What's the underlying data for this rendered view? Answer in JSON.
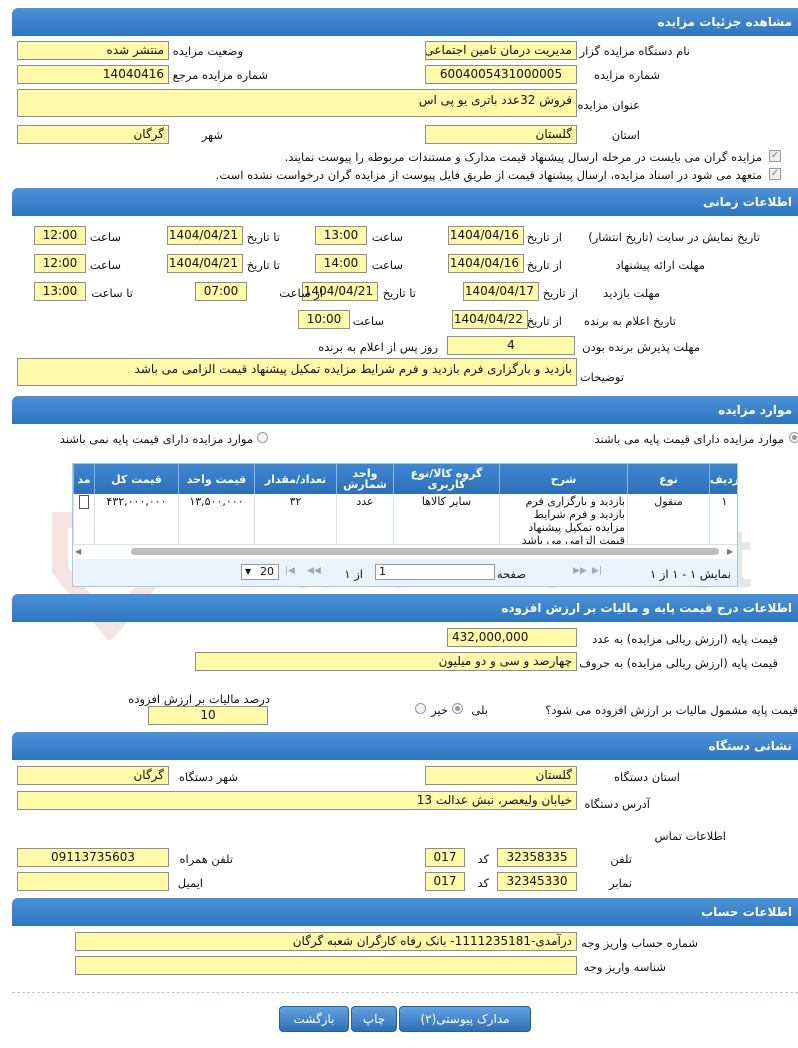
{
  "watermark": "AriaTender.net",
  "sections": {
    "details": "مشاهده جزئیات مزایده",
    "timing": "اطلاعات زمانی",
    "items": "موارد مزایده",
    "price": "اطلاعات درج قیمت پایه و مالیات بر ارزش افزوده",
    "address": "نشانی دستگاه",
    "account": "اطلاعات حساب"
  },
  "details": {
    "org_label": "نام دستگاه مزایده گزار",
    "org_value": "مدیریت درمان تامین اجتماعی",
    "status_label": "وضعیت مزایده",
    "status_value": "منتشر شده",
    "num_label": "شماره مزایده",
    "num_value": "6004005431000005",
    "ref_label": "شماره مزایده مرجع",
    "ref_value": "14040416",
    "title_label": "عنوان مزایده",
    "title_value": "فروش 32عدد باتری یو پی اس",
    "province_label": "استان",
    "province_value": "گلستان",
    "city_label": "شهر",
    "city_value": "گرگان",
    "check1": "مزایده گران می بایست در مرحله ارسال پیشنهاد قیمت مدارک و مستندات مربوطه را پیوست نمایند.",
    "check2": "متعهد می شود در اسناد مزایده، ارسال پیشنهاد قیمت از طریق فایل پیوست از مزایده گران درخواست نشده است."
  },
  "timing": {
    "r1_label": "تاریخ نمایش در سایت (تاریخ انتشار)",
    "r1_from_label": "از تاریخ",
    "r1_from": "1404/04/16",
    "r1_time1_label": "ساعت",
    "r1_time1": "13:00",
    "r1_to_label": "تا تاریخ",
    "r1_to": "1404/04/21",
    "r1_time2_label": "ساعت",
    "r1_time2": "12:00",
    "r2_label": "مهلت ارائه پیشنهاد",
    "r2_from_label": "از تاریخ",
    "r2_from": "1404/04/16",
    "r2_time1_label": "ساعت",
    "r2_time1": "14:00",
    "r2_to_label": "تا تاریخ",
    "r2_to": "1404/04/21",
    "r2_time2_label": "ساعت",
    "r2_time2": "12:00",
    "r3_label": "مهلت بازدید",
    "r3_from_label": "از تاریخ",
    "r3_from": "1404/04/17",
    "r3_to_label": "تا تاریخ",
    "r3_to": "1404/04/21",
    "r3_time1_label": "از ساعت",
    "r3_time1": "07:00",
    "r3_time2_label": "تا ساعت",
    "r3_time2": "13:00",
    "r4_label": "تاریخ اعلام به برنده",
    "r4_from_label": "از تاریخ",
    "r4_from": "1404/04/22",
    "r4_time_label": "ساعت",
    "r4_time": "10:00",
    "r5_label": "مهلت پذیرش برنده بودن",
    "r5_value": "4",
    "r5_suffix": "روز پس از اعلام به برنده",
    "desc_label": "توضیحات",
    "desc_value": "بازدید و بارگزاری فرم بازدید و فرم  شرایط مزایده  تمکیل پیشنهاد قیمت الزامی می باشد"
  },
  "items": {
    "radio_yes": "موارد مزایده دارای قیمت پایه می باشند",
    "radio_no": "موارد مزایده دارای قیمت پایه نمی باشند",
    "columns": [
      "ردیف",
      "نوع",
      "شرح",
      "گروه کالا/نوع کاربری",
      "واحد شمارش",
      "تعداد/مقدار",
      "قیمت واحد",
      "قیمت کل",
      "مد"
    ],
    "row": [
      "۱",
      "منقول",
      "بازدید و بارگزاری فرم بازدید و فرم  شرایط مزایده تمکیل پیشنهاد قیمت الزامی می باشد",
      "سایر کالاها",
      "عدد",
      "۳۲",
      "۱۳,۵۰۰,۰۰۰",
      "۴۳۲,۰۰۰,۰۰۰"
    ],
    "pager_show": "نمایش ۱ - ۱ از ۱",
    "pager_page": "صفحه",
    "pager_page_value": "1",
    "pager_of": "از ۱",
    "page_size": "20"
  },
  "price": {
    "base_num_label": "قیمت پایه (ارزش ریالی مزایده) به عدد",
    "base_num": "432,000,000",
    "base_text_label": "قیمت پایه (ارزش ریالی مزایده) به حروف",
    "base_text": "چهارصد و سی و دو میلیون",
    "vat_q": "قیمت پایه مشمول مالیات بر ارزش افزوده می شود؟",
    "yes": "بلی",
    "no": "خیر",
    "vat_pct_label": "درصد مالیات بر ارزش افزوده",
    "vat_pct": "10"
  },
  "address": {
    "province_label": "استان دستگاه",
    "province": "گلستان",
    "city_label": "شهر دستگاه",
    "city": "گرگان",
    "addr_label": "آدرس دستگاه",
    "addr": "خیابان ولیعصر، نبش عدالت 13",
    "contact_label": "اطلاعات تماس",
    "phone_label": "تلفن",
    "phone": "32358335",
    "code_label": "کد",
    "phone_code": "017",
    "mobile_label": "تلفن همراه",
    "mobile": "09113735603",
    "fax_label": "نمابر",
    "fax": "32345330",
    "fax_code_label": "کد",
    "fax_code": "017",
    "email_label": "ایمیل",
    "email": ""
  },
  "account": {
    "acc_label": "شماره حساب واریز وجه",
    "acc_value": "درآمدی-1111235181- بانک رفاه کارگران شعبه گرگان",
    "id_label": "شناسه واریز وجه",
    "id_value": ""
  },
  "buttons": {
    "attachments": "مدارک پیوستی(۲)",
    "print": "چاپ",
    "back": "بازگشت"
  }
}
